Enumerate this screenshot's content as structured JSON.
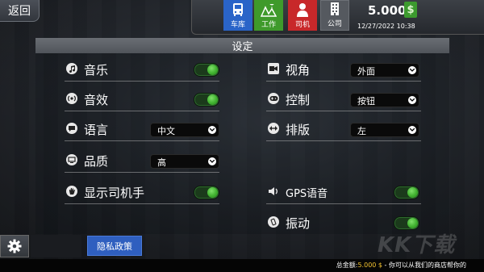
{
  "header": {
    "back_label": "返回"
  },
  "nav": {
    "garage": "车库",
    "jobs": "工作",
    "drivers": "司机",
    "company": "公司"
  },
  "status": {
    "money": "5.000",
    "money_symbol": "$",
    "datetime": "12/27/2022 10:38"
  },
  "panel": {
    "title": "设定",
    "left": [
      {
        "label": "音乐",
        "type": "toggle",
        "on": true,
        "icon": "music-note-icon"
      },
      {
        "label": "音效",
        "type": "toggle",
        "on": true,
        "icon": "sound-effect-icon"
      },
      {
        "label": "语言",
        "type": "dropdown",
        "value": "中文",
        "icon": "chat-bubble-icon"
      },
      {
        "label": "品质",
        "type": "dropdown",
        "value": "高",
        "icon": "monitor-icon"
      },
      {
        "label": "显示司机手",
        "type": "toggle",
        "on": true,
        "icon": "hand-icon"
      }
    ],
    "right": [
      {
        "label": "视角",
        "type": "dropdown",
        "value": "外面",
        "icon": "video-camera-icon"
      },
      {
        "label": "控制",
        "type": "dropdown",
        "value": "按钮",
        "icon": "gamepad-icon"
      },
      {
        "label": "排版",
        "type": "dropdown",
        "value": "左",
        "icon": "layout-arrows-icon"
      },
      {
        "label": "GPS语音",
        "type": "toggle",
        "on": true,
        "icon": "speaker-icon"
      },
      {
        "label": "振动",
        "type": "toggle",
        "on": true,
        "icon": "vibrate-phone-icon"
      }
    ]
  },
  "footer": {
    "privacy_label": "隐私政策",
    "ticker_prefix": "总金额:",
    "ticker_amount": "5.000 $",
    "ticker_rest": " - 你可以从我们的商店帮你的"
  },
  "watermark": "KK下载",
  "colors": {
    "toggle_on": "#3fb02e",
    "garage": "#2a64c8",
    "jobs": "#3f9a2b",
    "drivers": "#c8282a",
    "privacy": "#2f5fbf"
  }
}
